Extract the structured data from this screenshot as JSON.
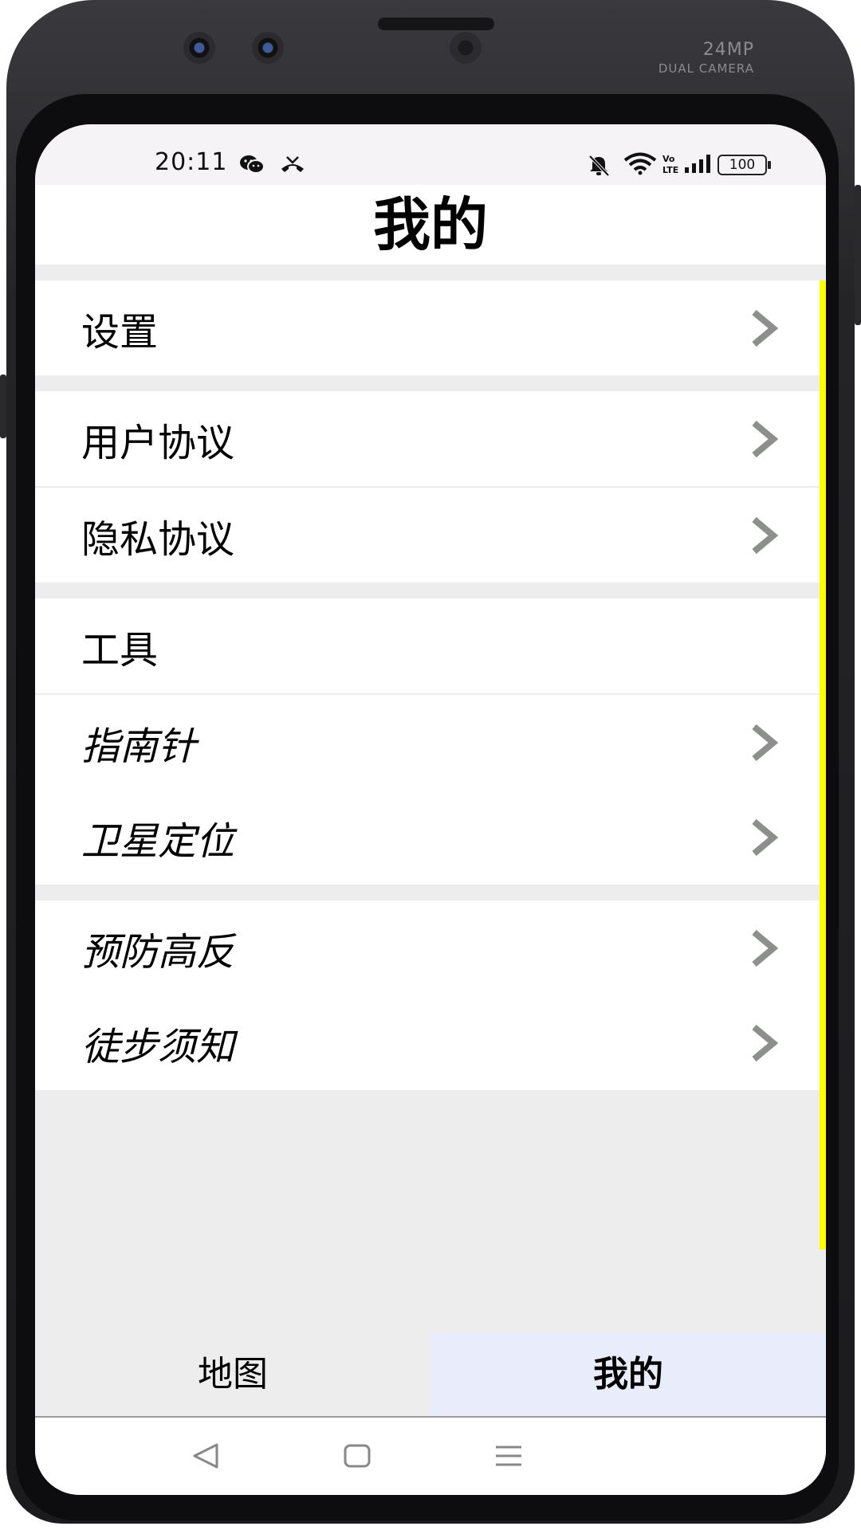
{
  "device": {
    "camera_label": "24MP",
    "camera_sublabel": "DUAL CAMERA"
  },
  "status_bar": {
    "time": "20:11",
    "battery": "100",
    "icons": [
      "wechat-icon",
      "missed-call-icon",
      "mute-icon",
      "wifi-icon",
      "volte-icon",
      "signal-icon"
    ]
  },
  "header": {
    "title": "我的"
  },
  "menu": {
    "settings": "设置",
    "user_agreement": "用户协议",
    "privacy_agreement": "隐私协议",
    "tools_title": "工具",
    "compass": "指南针",
    "satellite": "卫星定位",
    "altitude": "预防高反",
    "hiking": "徒步须知"
  },
  "tabs": {
    "map": "地图",
    "mine": "我的",
    "selected": "mine"
  },
  "colors": {
    "scroll_indicator": "#ffff00",
    "chevron": "#8c8f8c",
    "selected_tab_bg": "#e8ecfb",
    "page_bg": "#ededed"
  }
}
